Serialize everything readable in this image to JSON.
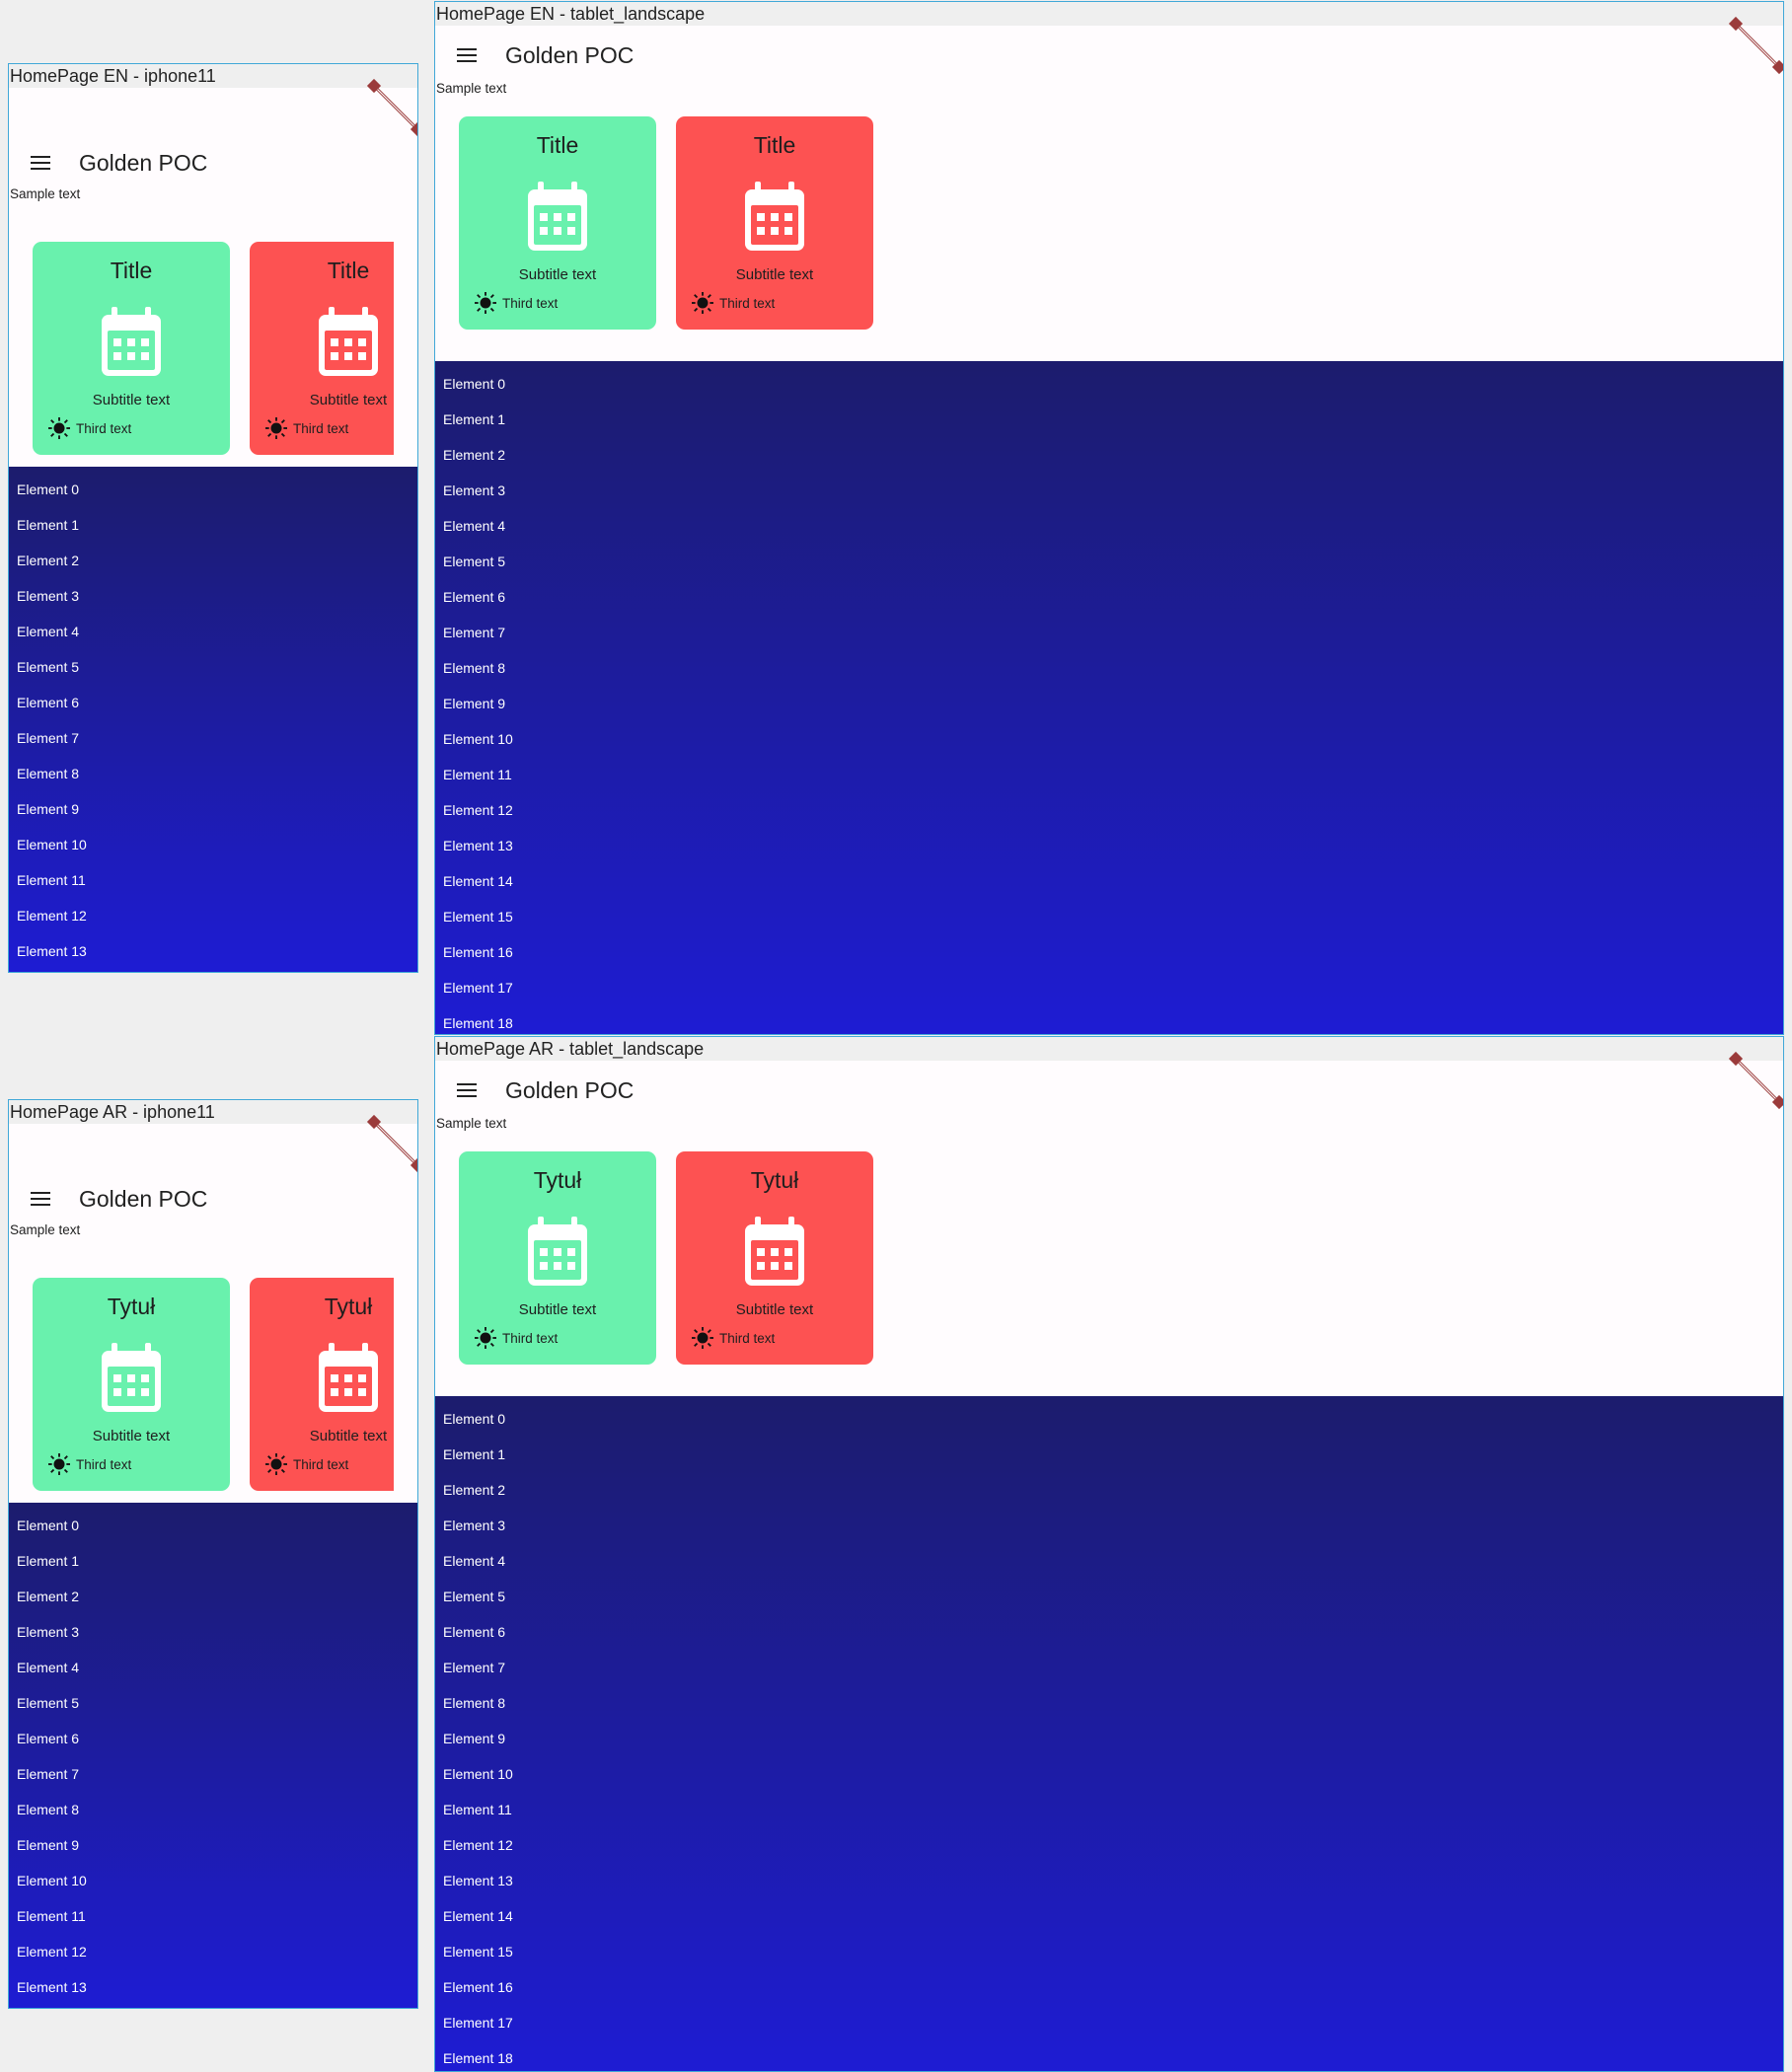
{
  "screens": [
    {
      "id": "iphone-en",
      "caption": "HomePage EN - iphone11",
      "cards": {
        "title": "Title"
      },
      "list_count": 14
    },
    {
      "id": "tablet-en",
      "caption": "HomePage EN - tablet_landscape",
      "cards": {
        "title": "Title"
      },
      "list_count": 19
    },
    {
      "id": "iphone-ar",
      "caption": "HomePage AR - iphone11",
      "cards": {
        "title": "Tytuł"
      },
      "list_count": 14
    },
    {
      "id": "tablet-ar",
      "caption": "HomePage AR - tablet_landscape",
      "cards": {
        "title": "Tytuł"
      },
      "list_count": 19
    }
  ],
  "app_title": "Golden POC",
  "sample_text": "Sample text",
  "card_subtitle": "Subtitle text",
  "card_third": "Third text",
  "elements": [
    "Element 0",
    "Element 1",
    "Element 2",
    "Element 3",
    "Element 4",
    "Element 5",
    "Element 6",
    "Element 7",
    "Element 8",
    "Element 9",
    "Element 10",
    "Element 11",
    "Element 12",
    "Element 13",
    "Element 14",
    "Element 15",
    "Element 16",
    "Element 17",
    "Element 18"
  ],
  "icons": {
    "menu": "menu-icon",
    "calendar": "calendar-icon",
    "sun": "sun-icon",
    "debug_banner": "debug-banner"
  },
  "colors": {
    "card_green": "#69f1ad",
    "card_red": "#fd5252",
    "list_top": "#1c1c6d",
    "list_bottom": "#1e1cd3",
    "frame_border": "#41a8d8"
  }
}
